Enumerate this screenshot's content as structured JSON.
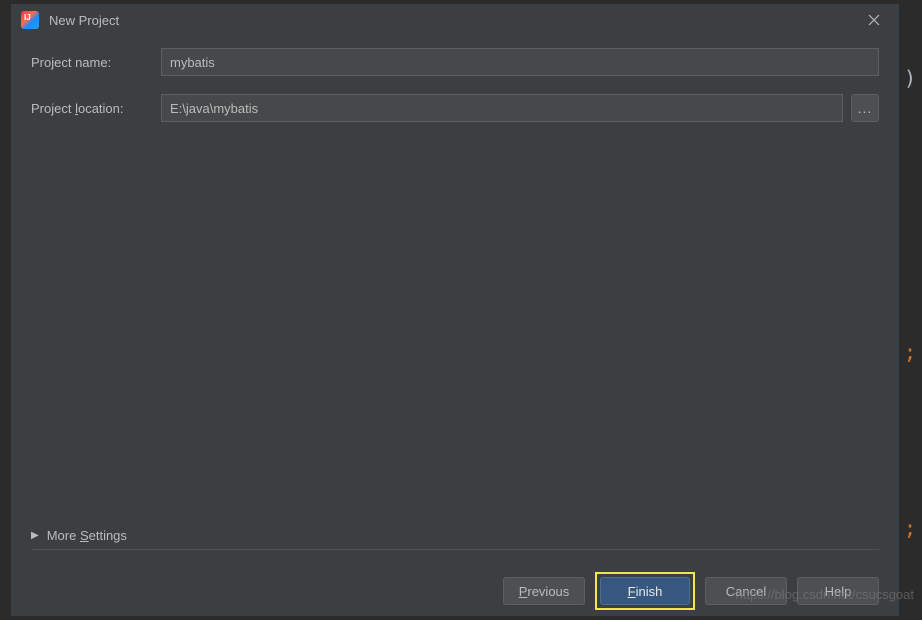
{
  "dialog": {
    "title": "New Project",
    "projectNameLabel": "Project name:",
    "projectNameValue": "mybatis",
    "projectLocationLabel_pre": "Project ",
    "projectLocationLabel_u": "l",
    "projectLocationLabel_post": "ocation:",
    "projectLocationValue": "E:\\java\\mybatis",
    "browseEllipsis": "...",
    "moreSettings_pre": "More ",
    "moreSettings_u": "S",
    "moreSettings_post": "ettings"
  },
  "buttons": {
    "previous_u": "P",
    "previous_post": "revious",
    "finish_u": "F",
    "finish_post": "inish",
    "cancel": "Cancel",
    "help": "Help"
  },
  "watermark": "https://blog.csdn.net/csucsgoat",
  "bg": {
    "paren": ")",
    "semi1": ";",
    "semi2": ";"
  }
}
